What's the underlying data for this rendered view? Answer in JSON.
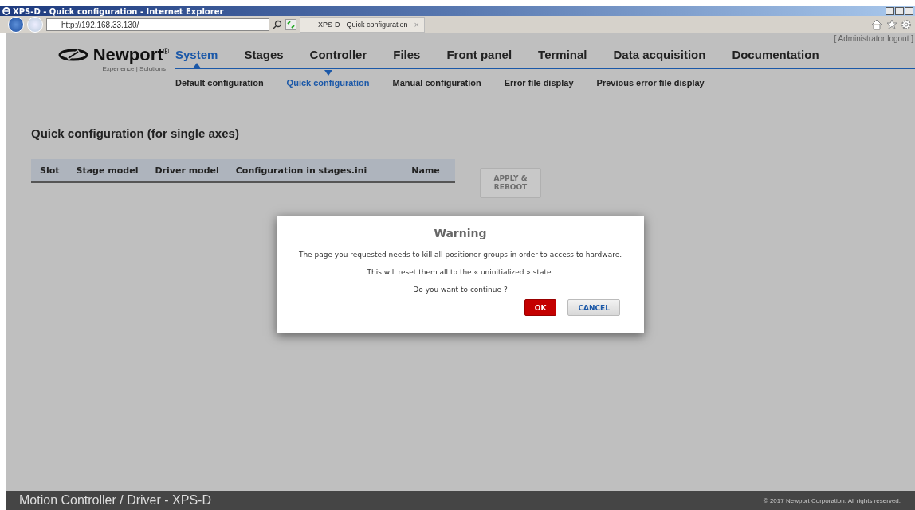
{
  "window": {
    "title": "XPS-D - Quick configuration - Internet Explorer"
  },
  "browser": {
    "url": "http://192.168.33.130/",
    "tab": {
      "label": "XPS-D - Quick configuration",
      "close": "×"
    }
  },
  "header": {
    "logo": "Newport",
    "logo_mark": "®",
    "tagline": "Experience | Solutions",
    "logout": "[ Administrator logout ]"
  },
  "nav": [
    {
      "label": "System",
      "selected": true
    },
    {
      "label": "Stages",
      "selected": false
    },
    {
      "label": "Controller",
      "selected": false
    },
    {
      "label": "Files",
      "selected": false
    },
    {
      "label": "Front panel",
      "selected": false
    },
    {
      "label": "Terminal",
      "selected": false
    },
    {
      "label": "Data acquisition",
      "selected": false
    },
    {
      "label": "Documentation",
      "selected": false
    }
  ],
  "subnav": [
    {
      "label": "Default configuration",
      "selected": false
    },
    {
      "label": "Quick configuration",
      "selected": true
    },
    {
      "label": "Manual configuration",
      "selected": false
    },
    {
      "label": "Error file display",
      "selected": false
    },
    {
      "label": "Previous error file display",
      "selected": false
    }
  ],
  "page": {
    "heading": "Quick configuration (for single axes)",
    "table": {
      "columns": [
        "Slot",
        "Stage model",
        "Driver model",
        "Configuration in stages.ini",
        "Name"
      ]
    },
    "apply_button": {
      "label": "APPLY & REBOOT",
      "disabled": true
    }
  },
  "dialog": {
    "title": "Warning",
    "lines": [
      "The page you requested needs to kill all positioner groups in order to access to hardware.",
      "This will reset them all to the « uninitialized » state.",
      "Do you want to continue ?"
    ],
    "buttons": [
      {
        "label": "OK",
        "kind": "primary"
      },
      {
        "label": "CANCEL",
        "kind": "secondary"
      }
    ]
  },
  "footer": {
    "title": "Motion Controller / Driver - XPS-D",
    "copyright": "© 2017 Newport Corporation. All rights reserved."
  }
}
